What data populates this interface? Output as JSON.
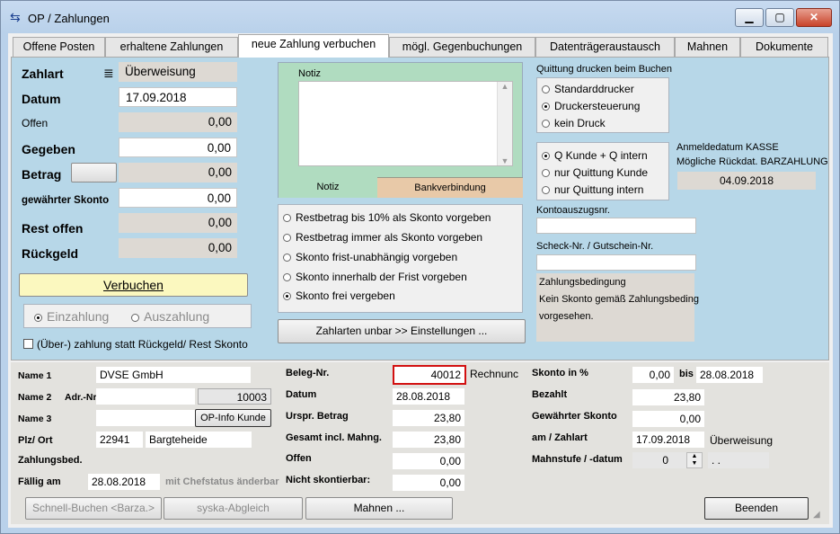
{
  "window": {
    "title": "OP / Zahlungen"
  },
  "tabs": [
    "Offene Posten",
    "erhaltene Zahlungen",
    "neue Zahlung verbuchen",
    "mögl. Gegenbuchungen",
    "Datenträgeraustausch",
    "Mahnen",
    "Dokumente"
  ],
  "left": {
    "zahlart_label": "Zahlart",
    "zahlart_value": "Überweisung",
    "datum_label": "Datum",
    "datum_value": "17.09.2018",
    "offen_label": "Offen",
    "offen_value": "0,00",
    "gegeben_label": "Gegeben",
    "gegeben_value": "0,00",
    "betrag_label": "Betrag",
    "betrag_value": "0,00",
    "skonto_label": "gewährter Skonto",
    "skonto_value": "0,00",
    "rest_label": "Rest offen",
    "rest_value": "0,00",
    "rueckgeld_label": "Rückgeld",
    "rueckgeld_value": "0,00",
    "verbuchen": "Verbuchen",
    "einzahlung": "Einzahlung",
    "auszahlung": "Auszahlung",
    "checkbox_label": "(Über-) zahlung statt Rückgeld/ Rest Skonto"
  },
  "notiz": {
    "label": "Notiz",
    "tab_notiz": "Notiz",
    "tab_bank": "Bankverbindung"
  },
  "skonto_options": [
    "Restbetrag bis 10% als Skonto vorgeben",
    "Restbetrag immer als Skonto vorgeben",
    "Skonto frist-unabhängig vorgeben",
    "Skonto innerhalb der Frist vorgeben",
    "Skonto frei vergeben"
  ],
  "zahlarten_button": "Zahlarten unbar >> Einstellungen ...",
  "quittung": {
    "label": "Quittung drucken beim Buchen",
    "options": [
      "Standarddrucker",
      "Druckersteuerung",
      "kein Druck"
    ],
    "kunde_options": [
      "Q Kunde + Q intern",
      "nur Quittung Kunde",
      "nur Quittung intern"
    ]
  },
  "anmelde": {
    "line1": "Anmeldedatum KASSE",
    "line2": "Mögliche Rückdat. BARZAHLUNG",
    "date": "04.09.2018"
  },
  "konto_label": "Kontoauszugsnr.",
  "scheck_label": "Scheck-Nr. / Gutschein-Nr.",
  "zahlungsbed": {
    "label": "Zahlungsbedingung",
    "text1": "Kein Skonto gemäß Zahlungsbeding",
    "text2": "vorgesehen."
  },
  "lower": {
    "name1_label": "Name 1",
    "name1_value": "DVSE GmbH",
    "name2_label": "Name 2",
    "adr_label": "Adr.-Nr.",
    "adr_value": "10003",
    "name3_label": "Name 3",
    "opinfo_button": "OP-Info Kunde",
    "plz_label": "Plz/ Ort",
    "plz_value": "22941",
    "ort_value": "Bargteheide",
    "zahlungsbed_label": "Zahlungsbed.",
    "faellig_label": "Fällig am",
    "faellig_value": "28.08.2018",
    "chefstatus": "mit Chefstatus änderbar",
    "beleg_label": "Beleg-Nr.",
    "beleg_value": "40012",
    "rechnung": "Rechnunc",
    "datum_label": "Datum",
    "datum_value": "28.08.2018",
    "urspr_label": "Urspr. Betrag",
    "urspr_value": "23,80",
    "gesamt_label": "Gesamt incl. Mahng.",
    "gesamt_value": "23,80",
    "offen_label": "Offen",
    "offen_value": "0,00",
    "nicht_label": "Nicht skontierbar:",
    "nicht_value": "0,00",
    "skontoproz_label": "Skonto in %",
    "skontoproz_value": "0,00",
    "bis_label": "bis",
    "bis_value": "28.08.2018",
    "bezahlt_label": "Bezahlt",
    "bezahlt_value": "23,80",
    "gew_label": "Gewährter Skonto",
    "gew_value": "0,00",
    "am_label": "am / Zahlart",
    "am_value": "17.09.2018",
    "zahlart_value": "Überweisung",
    "mahn_label": "Mahnstufe / -datum",
    "mahn_value": "0",
    "mahn_date": ". ."
  },
  "footer": {
    "schnell": "Schnell-Buchen <Barza.>",
    "syska": "syska-Abgleich",
    "mahnen": "Mahnen ...",
    "beenden": "Beenden"
  }
}
